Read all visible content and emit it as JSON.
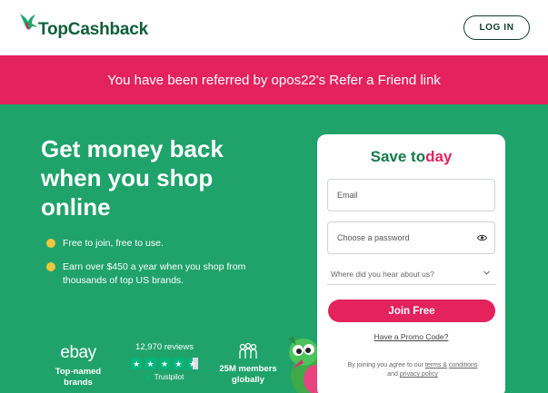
{
  "header": {
    "logo_text": "TopCashback",
    "login_label": "LOG IN"
  },
  "referral": {
    "message": "You have been referred by opos22's Refer a Friend link"
  },
  "hero": {
    "headline": "Get money back when you shop online",
    "bullets": [
      "Free to join, free to use.",
      "Earn over $450 a year when you shop from thousands of top US brands."
    ]
  },
  "stats": {
    "ebay_logo": "ebay",
    "ebay_caption": "Top-named brands",
    "reviews_count": "12,970 reviews",
    "trustpilot_label": "Trustpilot",
    "members_caption": "25M members globally"
  },
  "signup": {
    "title_part1": "Save to",
    "title_part2": "day",
    "email_placeholder": "Email",
    "password_placeholder": "Choose a password",
    "source_placeholder": "Where did you hear about us?",
    "join_label": "Join Free",
    "promo_label": "Have a Promo Code?",
    "terms_prefix": "By joining you agree to our",
    "terms_link": "terms &",
    "conditions_link": "conditions",
    "and_text": "and",
    "privacy_link": "privacy policy"
  },
  "colors": {
    "brand_green": "#1fa36a",
    "brand_pink": "#e3225e",
    "dark_green": "#0f5f3a",
    "bullet_yellow": "#f3c63f",
    "trustpilot_green": "#00b67a"
  }
}
